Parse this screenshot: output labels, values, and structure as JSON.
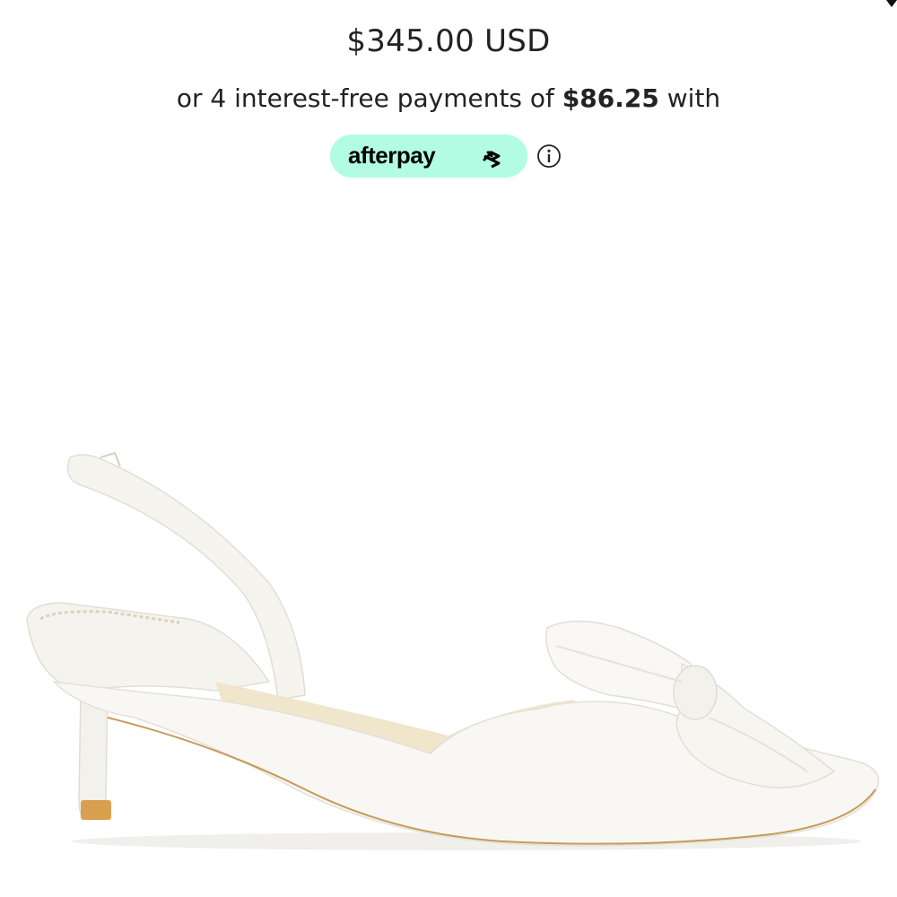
{
  "price": {
    "amount": "$345.00 USD"
  },
  "installments": {
    "prefix": "or 4 interest-free payments of ",
    "amount": "$86.25",
    "suffix": " with"
  },
  "afterpay": {
    "logo_text": "afterpay",
    "badge_color": "#b2fce4",
    "icon": "info-icon"
  },
  "product_image": {
    "icon": "shoe-image"
  }
}
